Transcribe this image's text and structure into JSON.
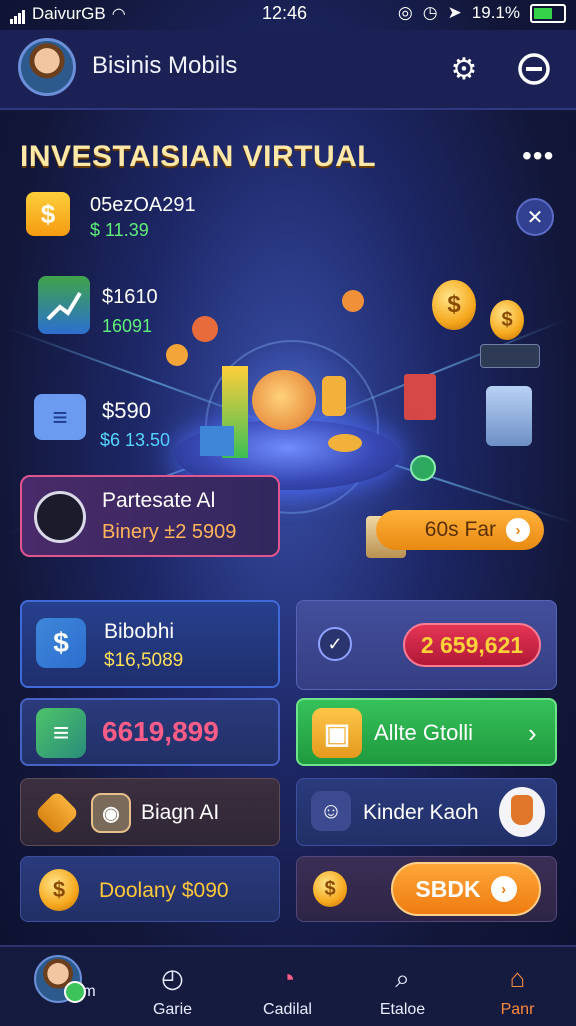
{
  "status_bar": {
    "carrier": "DaivurGB",
    "time": "12:46",
    "battery": "19.1%"
  },
  "header": {
    "title": "Bisinis Mobils"
  },
  "hero": {
    "title": "INVESTAISIAN VIRTUAL",
    "stats": [
      {
        "line1": "05ezOA291",
        "line2": "$ 11.39"
      },
      {
        "line1": "$1610",
        "line2": "16091"
      },
      {
        "line1": "$590",
        "line2": "$6 13.50"
      }
    ]
  },
  "promo": {
    "title": "Partesate Al",
    "subtitle": "Binery ±2 5909",
    "button_label": "60s Far"
  },
  "cards": {
    "bibobhi": {
      "title": "Bibobhi",
      "value": "$16,5089"
    },
    "right_value": "2 659,621",
    "big_value": "6619,899",
    "alte": {
      "label": "Allte Gtolli"
    },
    "design": {
      "label": "Biagn AI"
    },
    "kinder": {
      "label": "Kinder Kaoh"
    },
    "doolany": {
      "label": "Doolany $090"
    },
    "sdk_button": "SBDK"
  },
  "nav": [
    {
      "label": "Rim"
    },
    {
      "label": "Garie"
    },
    {
      "label": "Cadilal"
    },
    {
      "label": "Etaloe"
    },
    {
      "label": "Panr"
    }
  ],
  "colors": {
    "accent_orange": "#ff8a3d",
    "accent_green": "#5ef07a",
    "accent_pink": "#e0568f",
    "background": "#1d2766"
  }
}
